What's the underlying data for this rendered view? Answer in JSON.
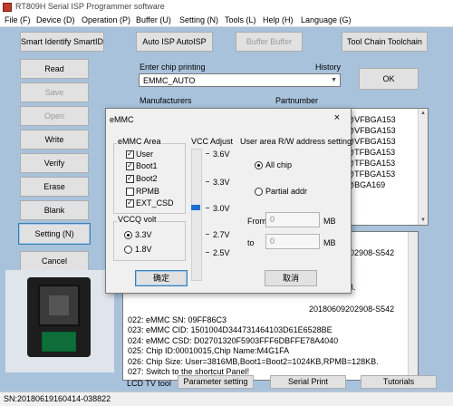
{
  "window": {
    "title": "RT809H Serial ISP Programmer software"
  },
  "menu": [
    "File (F)",
    "Device (D)",
    "Operation (P)",
    "Buffer (U)",
    "Setting (N)",
    "Tools (L)",
    "Help (H)",
    "Language (G)"
  ],
  "toolbar": {
    "smart_identify": "Smart Identify SmartID",
    "auto_isp": "Auto ISP AutoISP",
    "buffer": "Buffer Buffer",
    "tool_chain": "Tool Chain Toolchain"
  },
  "side_buttons": {
    "read": "Read",
    "save": "Save",
    "open": "Open",
    "write": "Write",
    "verify": "Verify",
    "erase": "Erase",
    "blank": "Blank",
    "setting": "Setting (N)",
    "cancel": "Cancel"
  },
  "chip": {
    "label": "Enter chip printing",
    "history": "History",
    "value": "EMMC_AUTO",
    "ok": "OK"
  },
  "lists": {
    "manufacturers": "Manufacturers",
    "partnumber": "Partnumber",
    "parts": [
      "@VFBGA153",
      "@VFBGA153",
      "@VFBGA153",
      "@TFBGA153",
      "@TFBGA153",
      "@TFBGA153",
      "@BGA169"
    ]
  },
  "log": {
    "lines": [
      "20180609202908-S542",
      "28KB.",
      "20180609202908-S542",
      "022:  eMMC SN: 09FF86C3",
      "023:  eMMC CID:  1501004D344731464103D61E6528BE",
      "024:  eMMC CSD: D02701320F5903FFF6DBFFE78A4040",
      "025:  Chip ID:00010015,Chip Name:M4G1FA",
      "026:  Chip Size: User=3816MB,Boot1=Boot2=1024KB,RPMB=128KB.",
      "027:  Switch to the shortcut Panel!"
    ]
  },
  "bottom_tabs": {
    "lcd_tv_tool": "LCD TV tool",
    "parameter_setting": "Parameter setting",
    "serial_print": "Serial Print",
    "tutorials": "Tutorials"
  },
  "status": {
    "sn": "SN:20180619160414-038822"
  },
  "dialog": {
    "title": "eMMC",
    "close": "×",
    "emmc_area": {
      "title": "eMMC Area",
      "options": [
        {
          "label": "User",
          "checked": true
        },
        {
          "label": "Boot1",
          "checked": true
        },
        {
          "label": "Boot2",
          "checked": true
        },
        {
          "label": "RPMB",
          "checked": false
        },
        {
          "label": "EXT_CSD",
          "checked": true
        }
      ]
    },
    "vccq": {
      "title": "VCCQ volt",
      "options": [
        {
          "label": "3.3V",
          "selected": true
        },
        {
          "label": "1.8V",
          "selected": false
        }
      ]
    },
    "vcc_adjust": {
      "title": "VCC Adjust",
      "ticks": [
        "3.6V",
        "3.3V",
        "3.0V",
        "2.7V",
        "2.5V"
      ],
      "value": "3.0V"
    },
    "user_area": {
      "title": "User area R/W address setting",
      "all_chip": "All chip",
      "partial_addr": "Partial addr",
      "mode": "all_chip",
      "from_label": "From",
      "from_value": "0",
      "to_label": "to",
      "to_value": "0",
      "unit": "MB"
    },
    "confirm": "确定",
    "cancel": "取消"
  },
  "colors": {
    "workspace": "#a8c2dc",
    "accent": "#1f6fd1",
    "titlebar_icon": "#c0392b"
  },
  "icons": {
    "app": "rt809h-app-icon",
    "dropdown": "chevron-down-icon",
    "close": "close-icon"
  }
}
